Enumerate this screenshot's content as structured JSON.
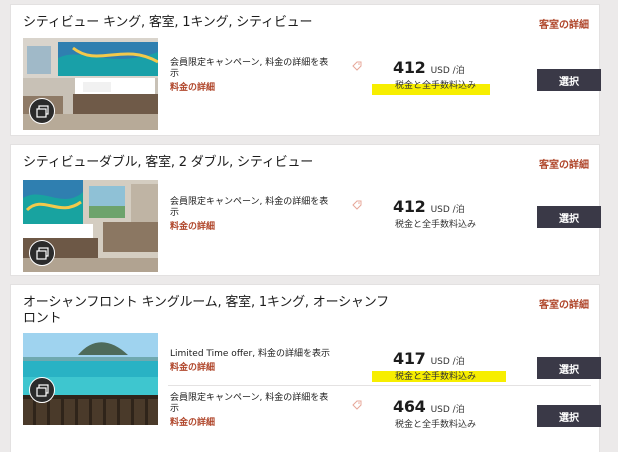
{
  "room_details_label": "客室の詳細",
  "rates_details_label": "料金の詳細",
  "select_label": "選択",
  "rooms": [
    {
      "title": "シティビュー キング, 客室, 1キング, シティビュー",
      "image_icon": "gallery-icon",
      "rates": [
        {
          "description": "会員限定キャンペーン, 料金の詳細を表示",
          "amount": "412",
          "unit": "USD /泊",
          "note": "税金と全手数料込み",
          "icon": "tag-icon"
        }
      ]
    },
    {
      "title": "シティビューダブル, 客室, 2 ダブル, シティビュー",
      "image_icon": "gallery-icon",
      "rates": [
        {
          "description": "会員限定キャンペーン, 料金の詳細を表示",
          "amount": "412",
          "unit": "USD /泊",
          "note": "税金と全手数料込み",
          "icon": "tag-icon"
        }
      ]
    },
    {
      "title": "オーシャンフロント キングルーム, 客室, 1キング, オーシャンフロント",
      "image_icon": "gallery-icon",
      "rates": [
        {
          "description": "Limited Time offer, 料金の詳細を表示",
          "amount": "417",
          "unit": "USD /泊",
          "note": "税金と全手数料込み"
        },
        {
          "description": "会員限定キャンペーン, 料金の詳細を表示",
          "amount": "464",
          "unit": "USD /泊",
          "note": "税金と全手数料込み",
          "icon": "tag-icon"
        }
      ]
    }
  ],
  "colors": {
    "accent": "#b0472c",
    "button": "#3a3947",
    "highlight": "#f7ee00",
    "background": "#eceaea"
  }
}
